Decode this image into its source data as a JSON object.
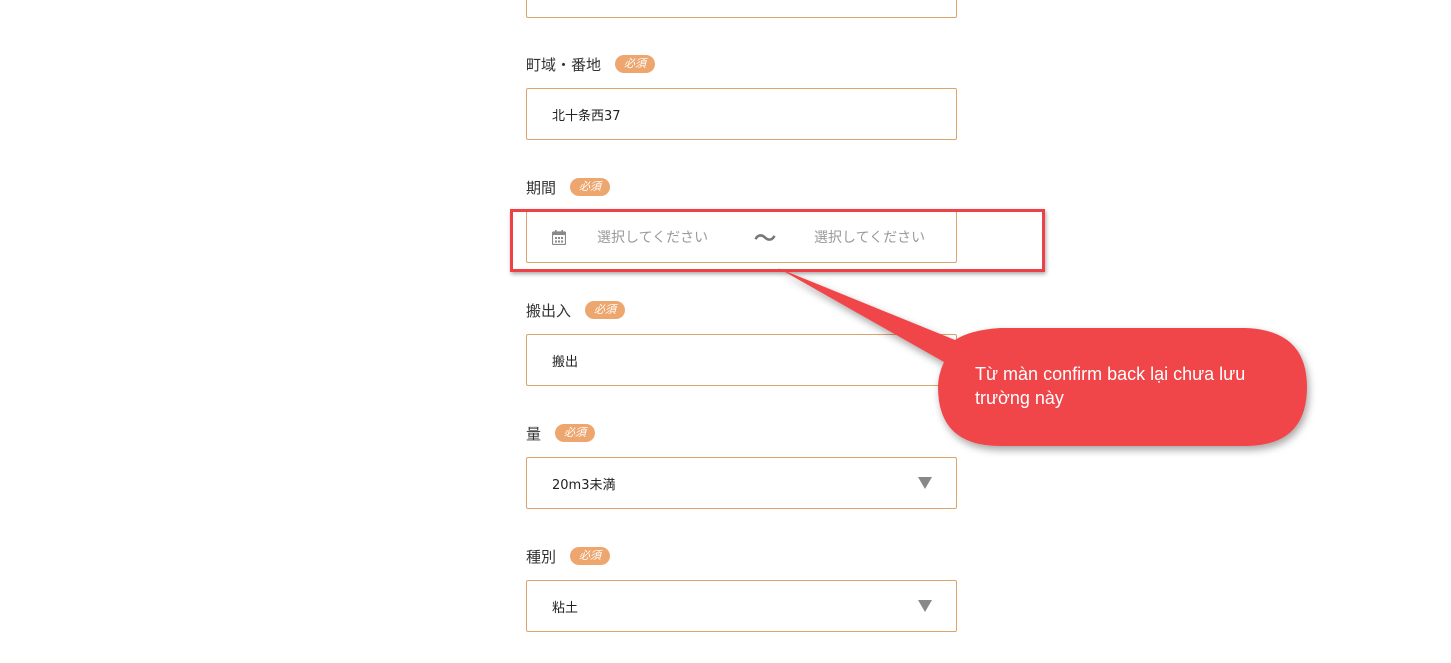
{
  "form": {
    "required_badge": "必須",
    "address_street": {
      "label": "町域・番地",
      "value": "北十条西37"
    },
    "period": {
      "label": "期間",
      "start_placeholder": "選択してください",
      "separator": "〜",
      "end_placeholder": "選択してください",
      "icon": "calendar-icon"
    },
    "carry": {
      "label": "搬出入",
      "value": "搬出"
    },
    "amount": {
      "label": "量",
      "value": "20m3未満",
      "icon": "dropdown-arrow-icon"
    },
    "type": {
      "label": "種別",
      "value": "粘土",
      "icon": "dropdown-arrow-icon"
    }
  },
  "annotation": {
    "text": "Từ màn confirm back lại chưa lưu trường này",
    "color": "#f04448"
  },
  "colors": {
    "field_border": "#dca36c",
    "badge_bg": "#eea66f",
    "highlight": "#ee4047"
  }
}
